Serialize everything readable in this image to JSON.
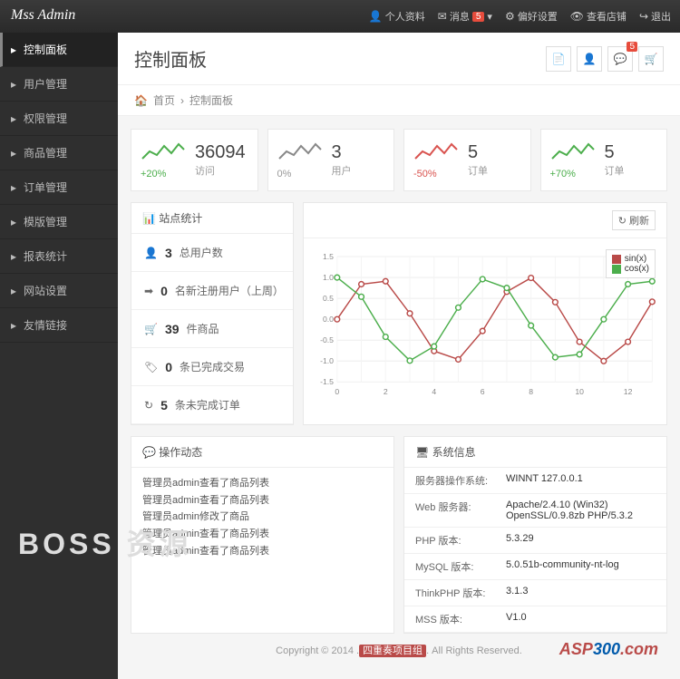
{
  "brand": "Mss Admin",
  "topnav": {
    "profile": "个人资料",
    "messages": "消息",
    "messages_count": "5",
    "settings": "偏好设置",
    "view_shop": "查看店铺",
    "logout": "退出"
  },
  "page_title": "控制面板",
  "head_buttons_badge": "5",
  "breadcrumb": {
    "home": "首页",
    "current": "控制面板"
  },
  "sidebar": [
    {
      "label": "控制面板",
      "active": true
    },
    {
      "label": "用户管理"
    },
    {
      "label": "权限管理"
    },
    {
      "label": "商品管理"
    },
    {
      "label": "订单管理"
    },
    {
      "label": "模版管理"
    },
    {
      "label": "报表统计"
    },
    {
      "label": "网站设置"
    },
    {
      "label": "友情链接"
    }
  ],
  "stats": [
    {
      "value": "36094",
      "label": "访问",
      "pct": "+20%",
      "cls": "pct-green",
      "color": "#4cae4c"
    },
    {
      "value": "3",
      "label": "用户",
      "pct": "0%",
      "cls": "pct-grey",
      "color": "#888"
    },
    {
      "value": "5",
      "label": "订单",
      "pct": "-50%",
      "cls": "pct-red",
      "color": "#d9534f"
    },
    {
      "value": "5",
      "label": "订单",
      "pct": "+70%",
      "cls": "pct-green",
      "color": "#4cae4c"
    }
  ],
  "site_stats_title": "站点统计",
  "refresh_label": "刷新",
  "stats_list": [
    {
      "icon": "👤",
      "num": "3",
      "label": "总用户数"
    },
    {
      "icon": "➡",
      "num": "0",
      "label": "名新注册用户（上周）"
    },
    {
      "icon": "🛒",
      "num": "39",
      "label": "件商品"
    },
    {
      "icon": "🏷",
      "num": "0",
      "label": "条已完成交易"
    },
    {
      "icon": "↻",
      "num": "5",
      "label": "条未完成订单"
    }
  ],
  "chart_data": {
    "type": "line",
    "x": [
      0,
      1,
      2,
      3,
      4,
      5,
      6,
      7,
      8,
      9,
      10,
      11,
      12,
      13
    ],
    "series": [
      {
        "name": "sin(x)",
        "color": "#b94a48",
        "values": [
          0,
          0.84,
          0.91,
          0.14,
          -0.76,
          -0.96,
          -0.28,
          0.66,
          0.99,
          0.41,
          -0.54,
          -1.0,
          -0.54,
          0.42
        ]
      },
      {
        "name": "cos(x)",
        "color": "#4cae4c",
        "values": [
          1.0,
          0.54,
          -0.42,
          -0.99,
          -0.65,
          0.28,
          0.96,
          0.75,
          -0.15,
          -0.91,
          -0.84,
          0.0,
          0.84,
          0.91
        ]
      }
    ],
    "ylim": [
      -1.5,
      1.5
    ],
    "xlim": [
      0,
      13
    ],
    "yticks": [
      -1.5,
      -1.0,
      -0.5,
      0,
      0.5,
      1.0,
      1.5
    ]
  },
  "ops_title": "操作动态",
  "ops_lines": [
    "管理员admin查看了商品列表",
    "管理员admin查看了商品列表",
    "管理员admin修改了商品",
    "管理员admin查看了商品列表",
    "管理员admin查看了商品列表"
  ],
  "sys_title": "系统信息",
  "sys_rows": [
    {
      "k": "服务器操作系统:",
      "v": "WINNT 127.0.0.1"
    },
    {
      "k": "Web 服务器:",
      "v": "Apache/2.4.10 (Win32) OpenSSL/0.9.8zb PHP/5.3.2"
    },
    {
      "k": "PHP 版本:",
      "v": "5.3.29"
    },
    {
      "k": "MySQL 版本:",
      "v": "5.0.51b-community-nt-log"
    },
    {
      "k": "ThinkPHP 版本:",
      "v": "3.1.3"
    },
    {
      "k": "MSS 版本:",
      "v": "V1.0"
    }
  ],
  "footer": {
    "copyright": "Copyright © 2014 .",
    "team": "四重奏项目组",
    "rights": ". All Rights Reserved."
  },
  "watermark": "BOSS 资源"
}
